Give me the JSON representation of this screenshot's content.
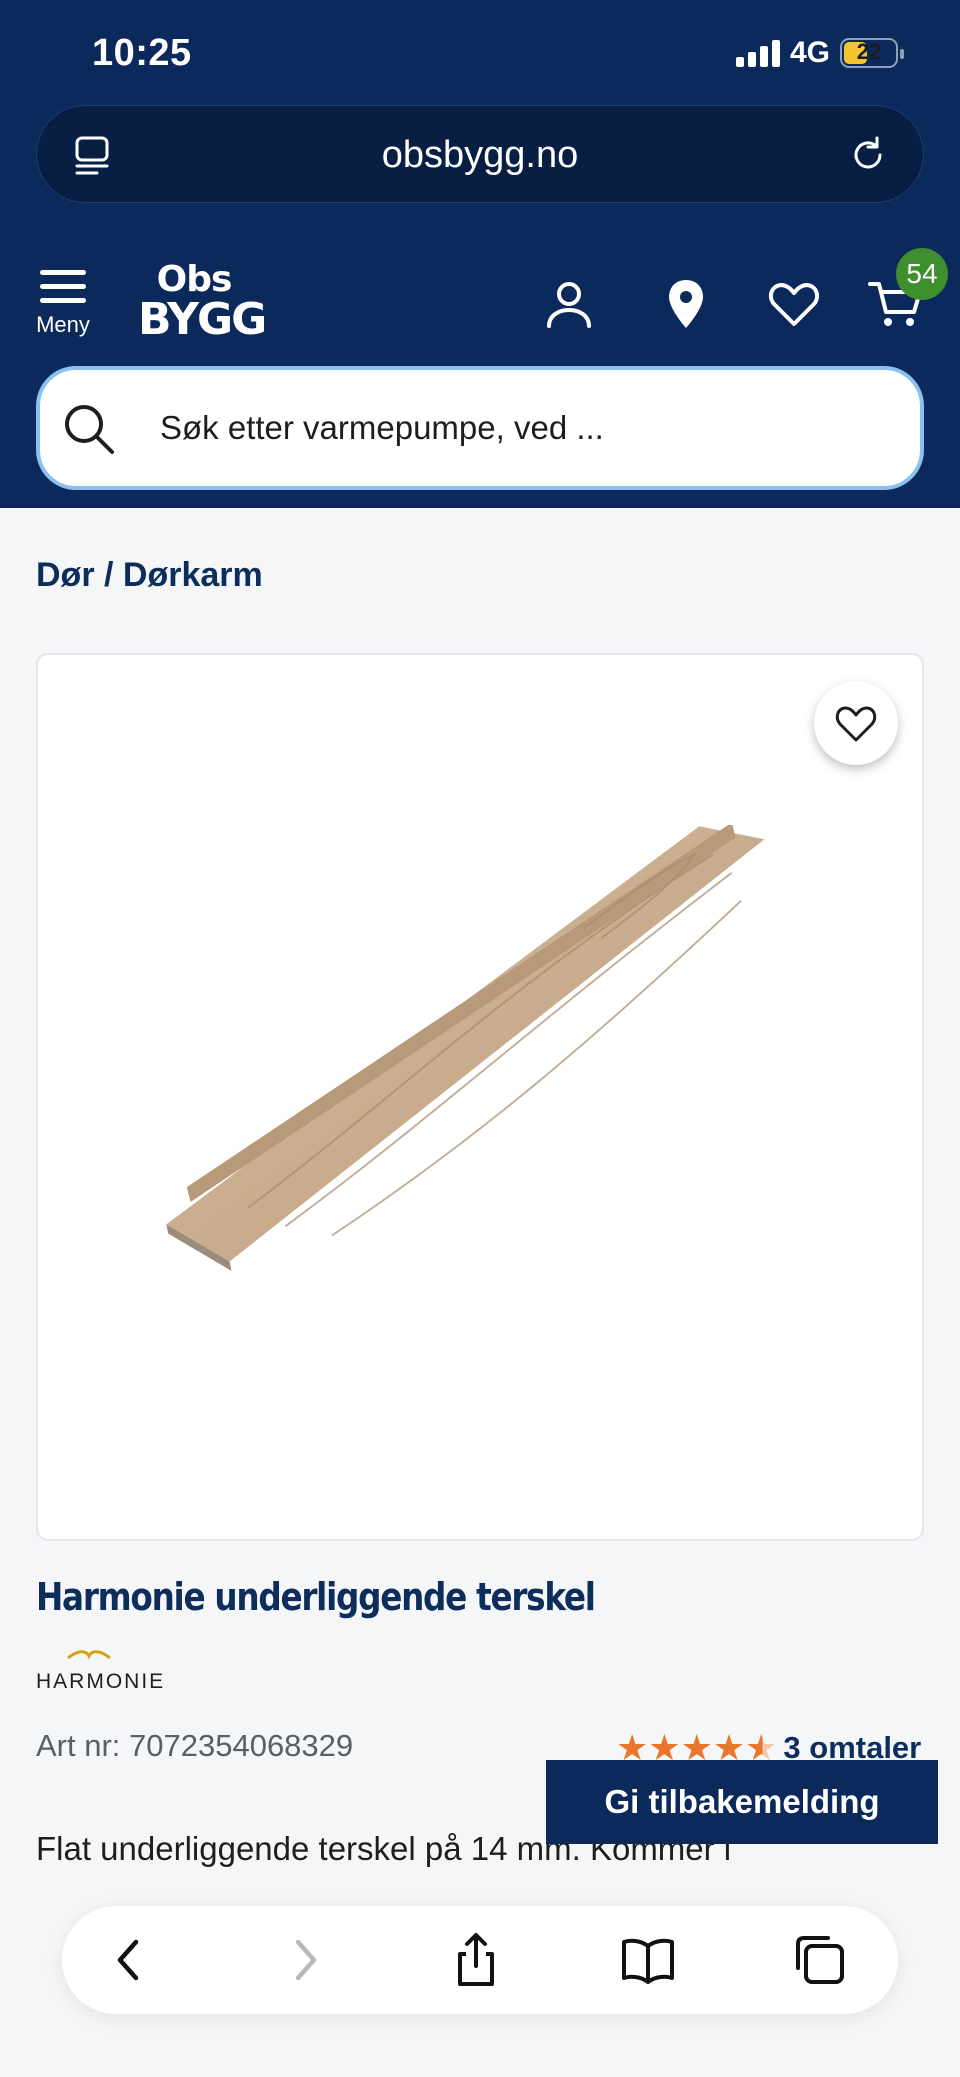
{
  "status_bar": {
    "time": "10:25",
    "network": "4G",
    "battery": "22"
  },
  "browser": {
    "url": "obsbygg.no"
  },
  "header": {
    "menu_label": "Meny",
    "logo_line1": "Obs",
    "logo_line2": "BYGG",
    "cart_count": "54",
    "search_placeholder": "Søk etter varmepumpe, ved ..."
  },
  "breadcrumb": "Dør / Dørkarm",
  "product": {
    "title": "Harmonie underliggende terskel",
    "brand": "HARMONIE",
    "art_nr": "Art nr: 7072354068329",
    "rating_value": 4.5,
    "rating_max": 5,
    "reviews": "3 omtaler",
    "description": "Flat underliggende terskel på 14 mm. Kommer i"
  },
  "feedback_button": "Gi tilbakemelding",
  "colors": {
    "header_bg": "#0b2a5b",
    "accent_orange": "#e8762c",
    "badge_green": "#3f8f2f"
  }
}
